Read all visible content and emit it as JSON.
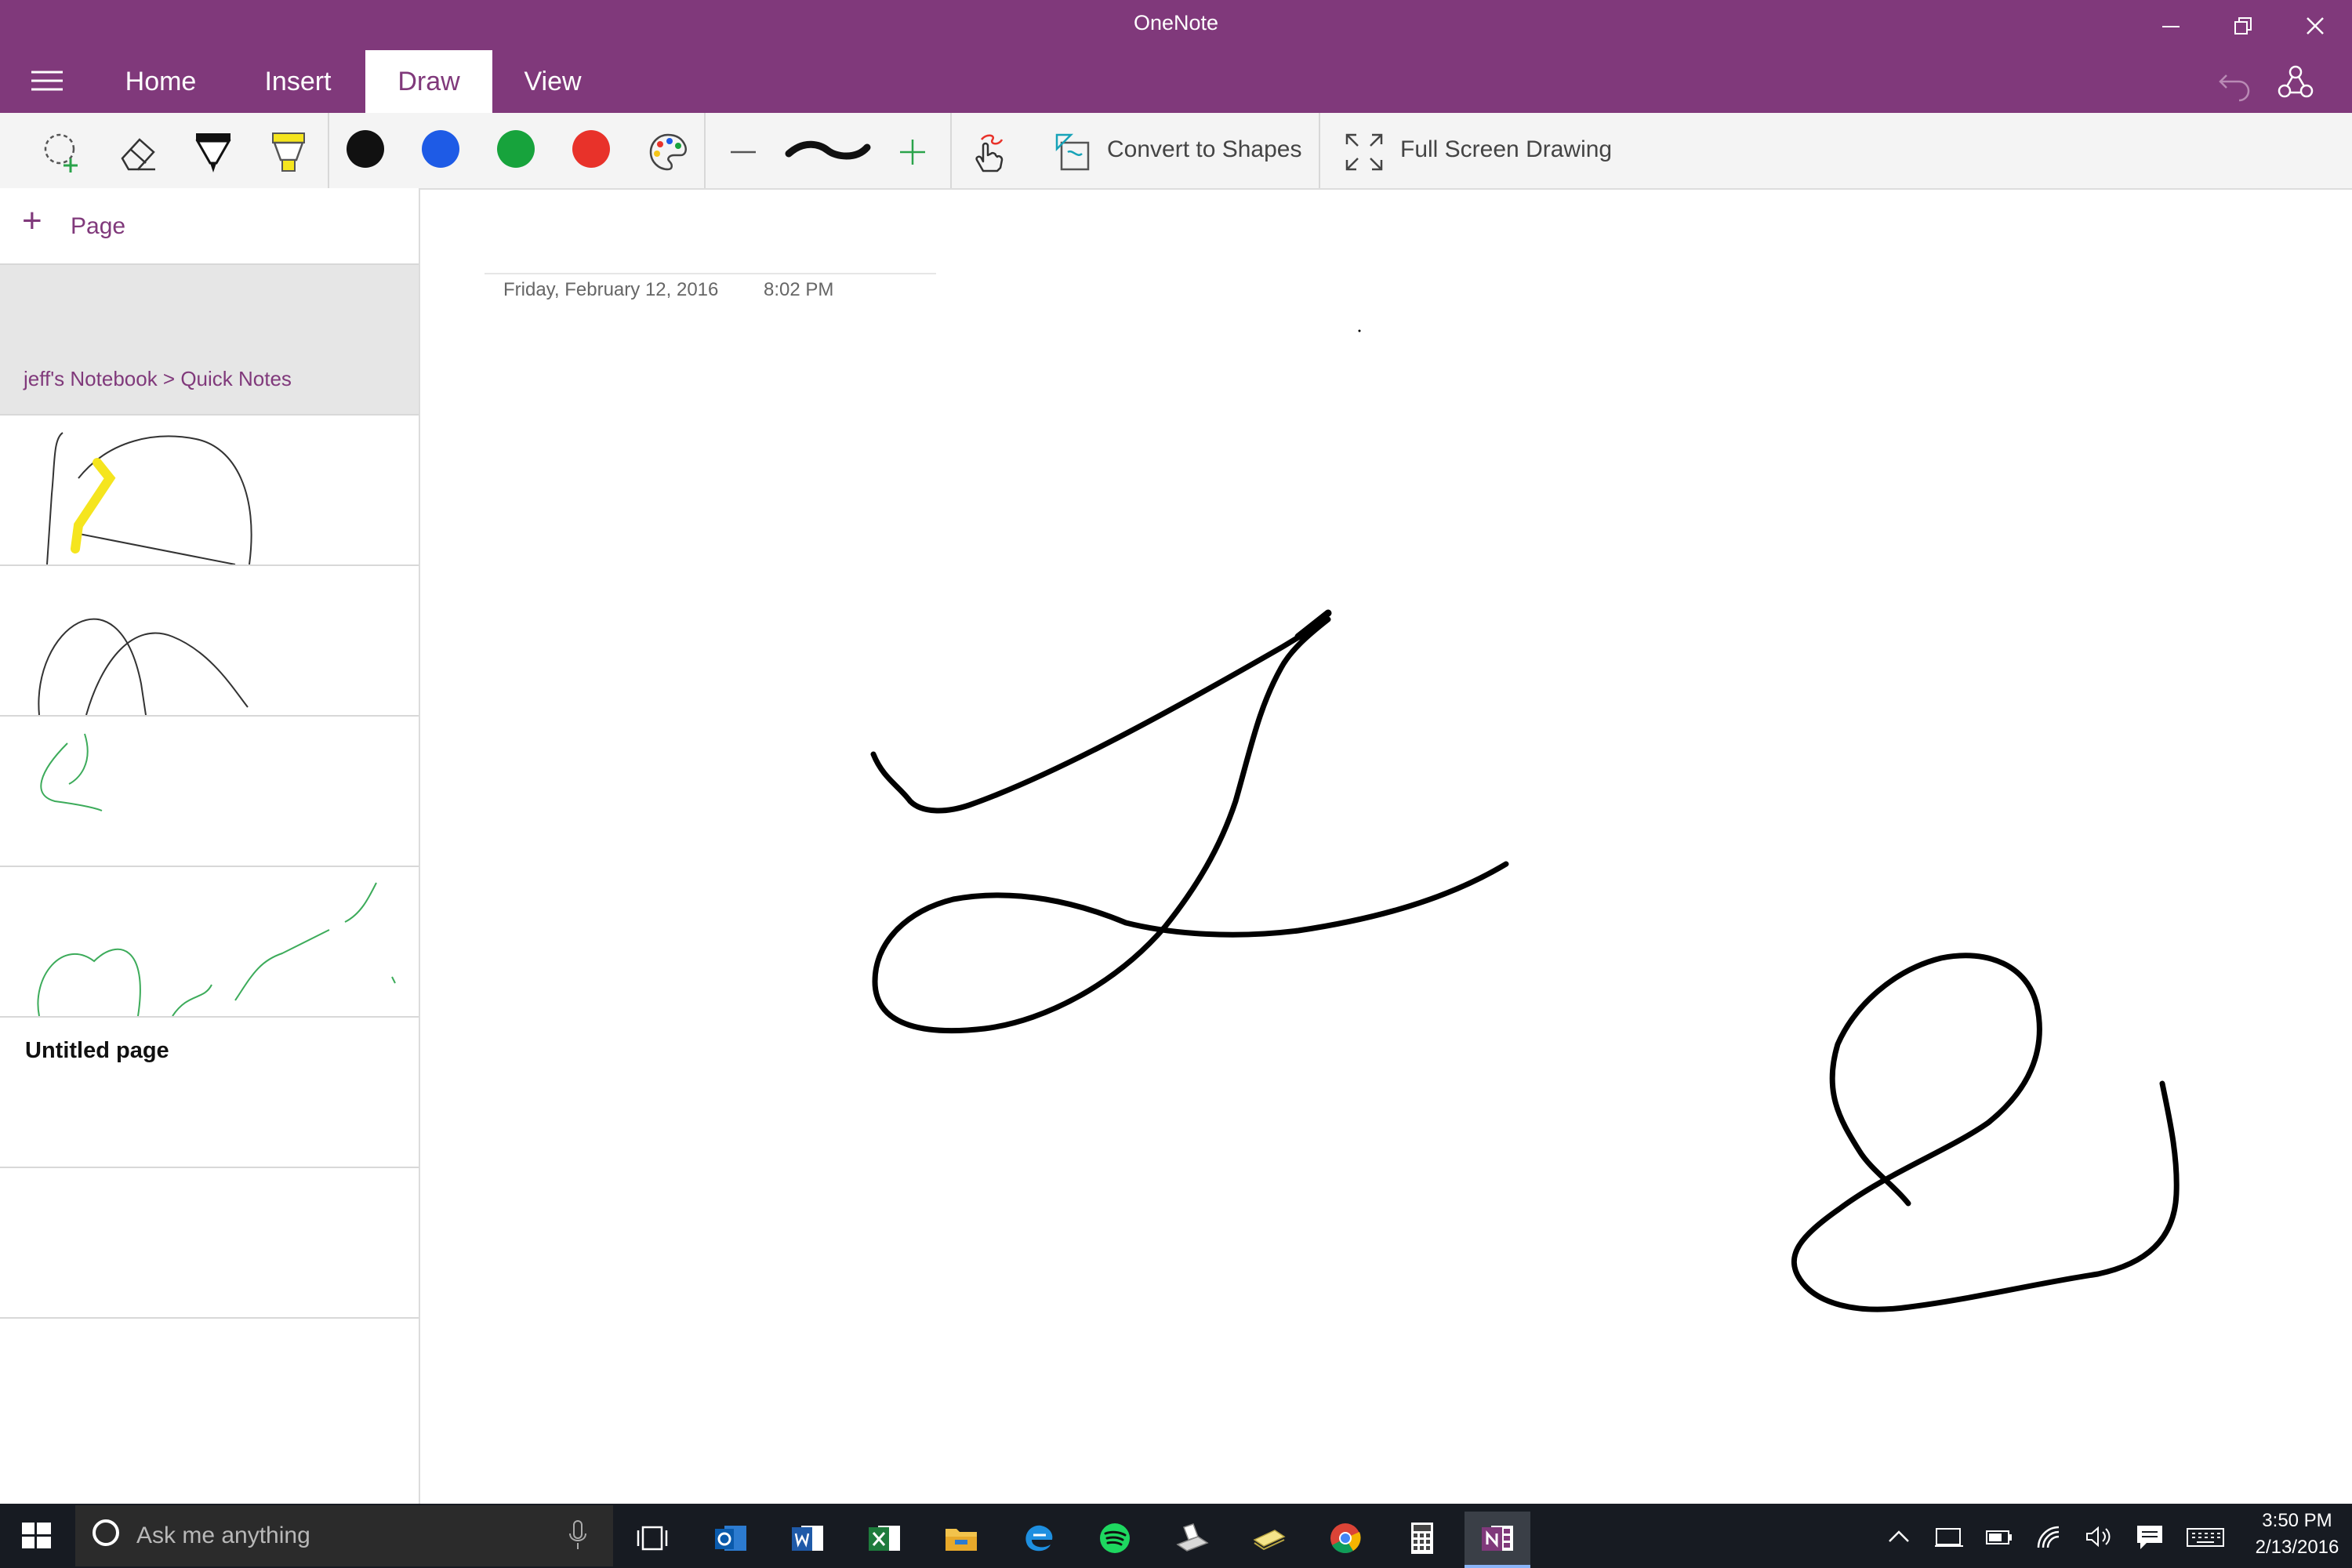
{
  "app": {
    "title": "OneNote",
    "accent": "#80397b"
  },
  "tabs": [
    {
      "label": "Home"
    },
    {
      "label": "Insert"
    },
    {
      "label": "Draw",
      "active": true
    },
    {
      "label": "View"
    }
  ],
  "ribbon": {
    "tools": [
      "lasso-select-icon",
      "eraser-icon",
      "pen-icon",
      "highlighter-icon"
    ],
    "colors": [
      "#111111",
      "#1e5be6",
      "#17a33c",
      "#e8322a"
    ],
    "more_colors_icon": "palette-icon",
    "thickness_decrease": "minus-icon",
    "thickness_increase": "plus-icon",
    "touch_drawing_icon": "touch-drawing-icon",
    "convert_label": "Convert to Shapes",
    "fullscreen_label": "Full Screen Drawing"
  },
  "pages_pane": {
    "add_page_label": "Page",
    "breadcrumb": "jeff's Notebook  >  Quick Notes",
    "untitled_title": "Untitled page"
  },
  "page": {
    "date": "Friday, February 12, 2016",
    "time": "8:02 PM"
  },
  "taskbar": {
    "search_placeholder": "Ask me anything",
    "apps": [
      "outlook-icon",
      "word-icon",
      "excel-icon",
      "file-explorer-icon",
      "edge-icon",
      "spotify-icon",
      "scanner-icon",
      "sticky-notes-icon",
      "chrome-icon",
      "calculator-icon",
      "onenote-icon"
    ],
    "time": "3:50 PM",
    "date": "2/13/2016"
  }
}
